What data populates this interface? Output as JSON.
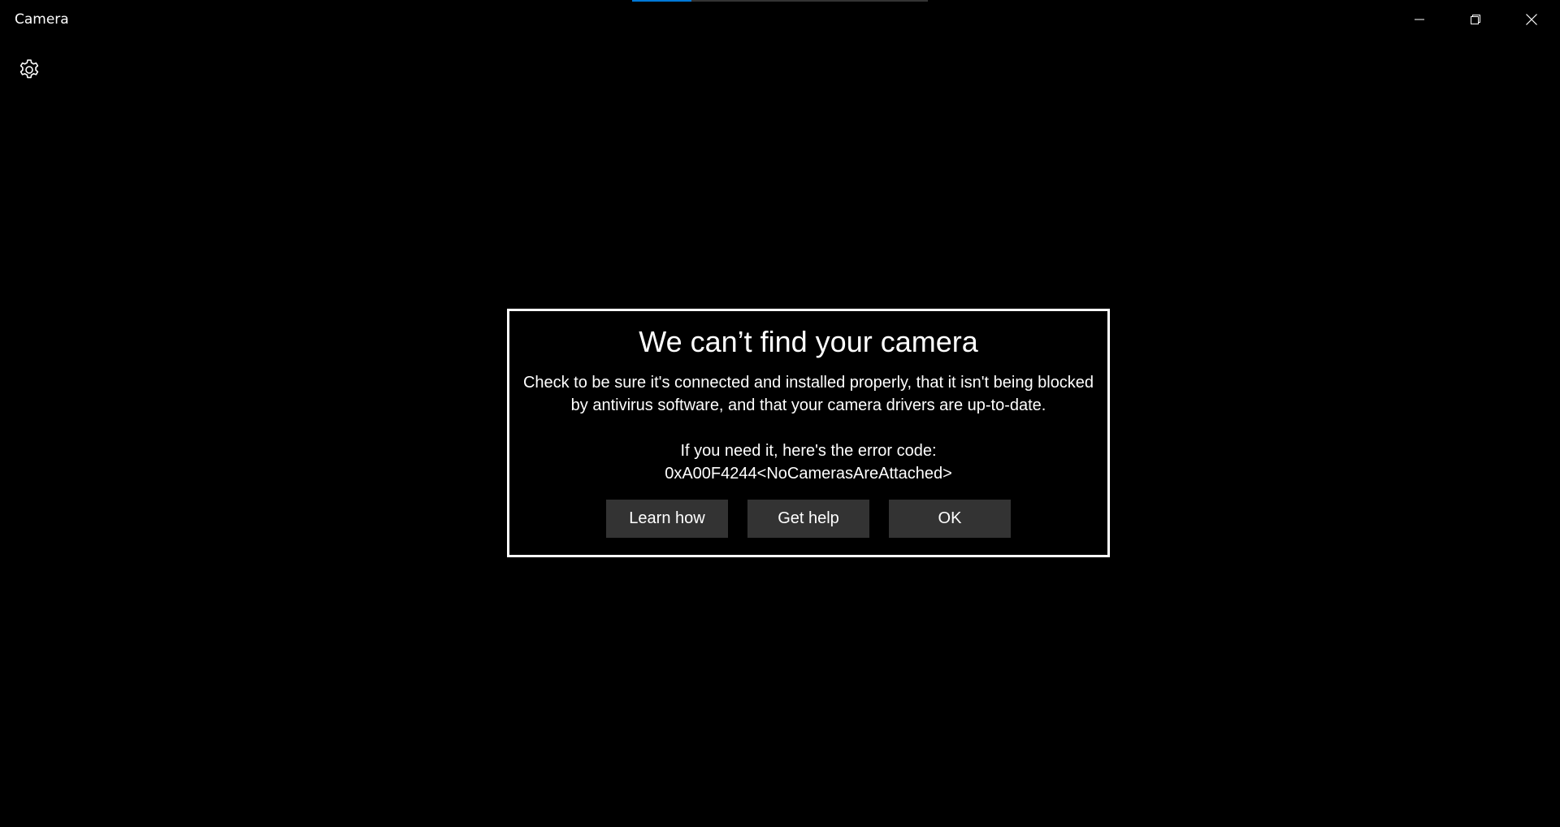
{
  "window": {
    "title": "Camera",
    "progress_fraction": 0.2
  },
  "titlebar_controls": {
    "minimize_icon": "minimize-icon",
    "restore_icon": "restore-icon",
    "close_icon": "close-icon"
  },
  "toolbar": {
    "settings_icon": "gear-icon"
  },
  "dialog": {
    "title": "We can’t find your camera",
    "body_line1": "Check to be sure it's connected and installed properly, that it isn't being blocked",
    "body_line2": "by antivirus software, and that your camera drivers are up-to-date.",
    "error_intro": "If you need it, here's the error code:",
    "error_code": "0xA00F4244<NoCamerasAreAttached>",
    "buttons": {
      "learn_how": "Learn how",
      "get_help": "Get help",
      "ok": "OK"
    }
  },
  "colors": {
    "background": "#000000",
    "text": "#ffffff",
    "button_bg": "#333333",
    "accent": "#0078d7"
  }
}
